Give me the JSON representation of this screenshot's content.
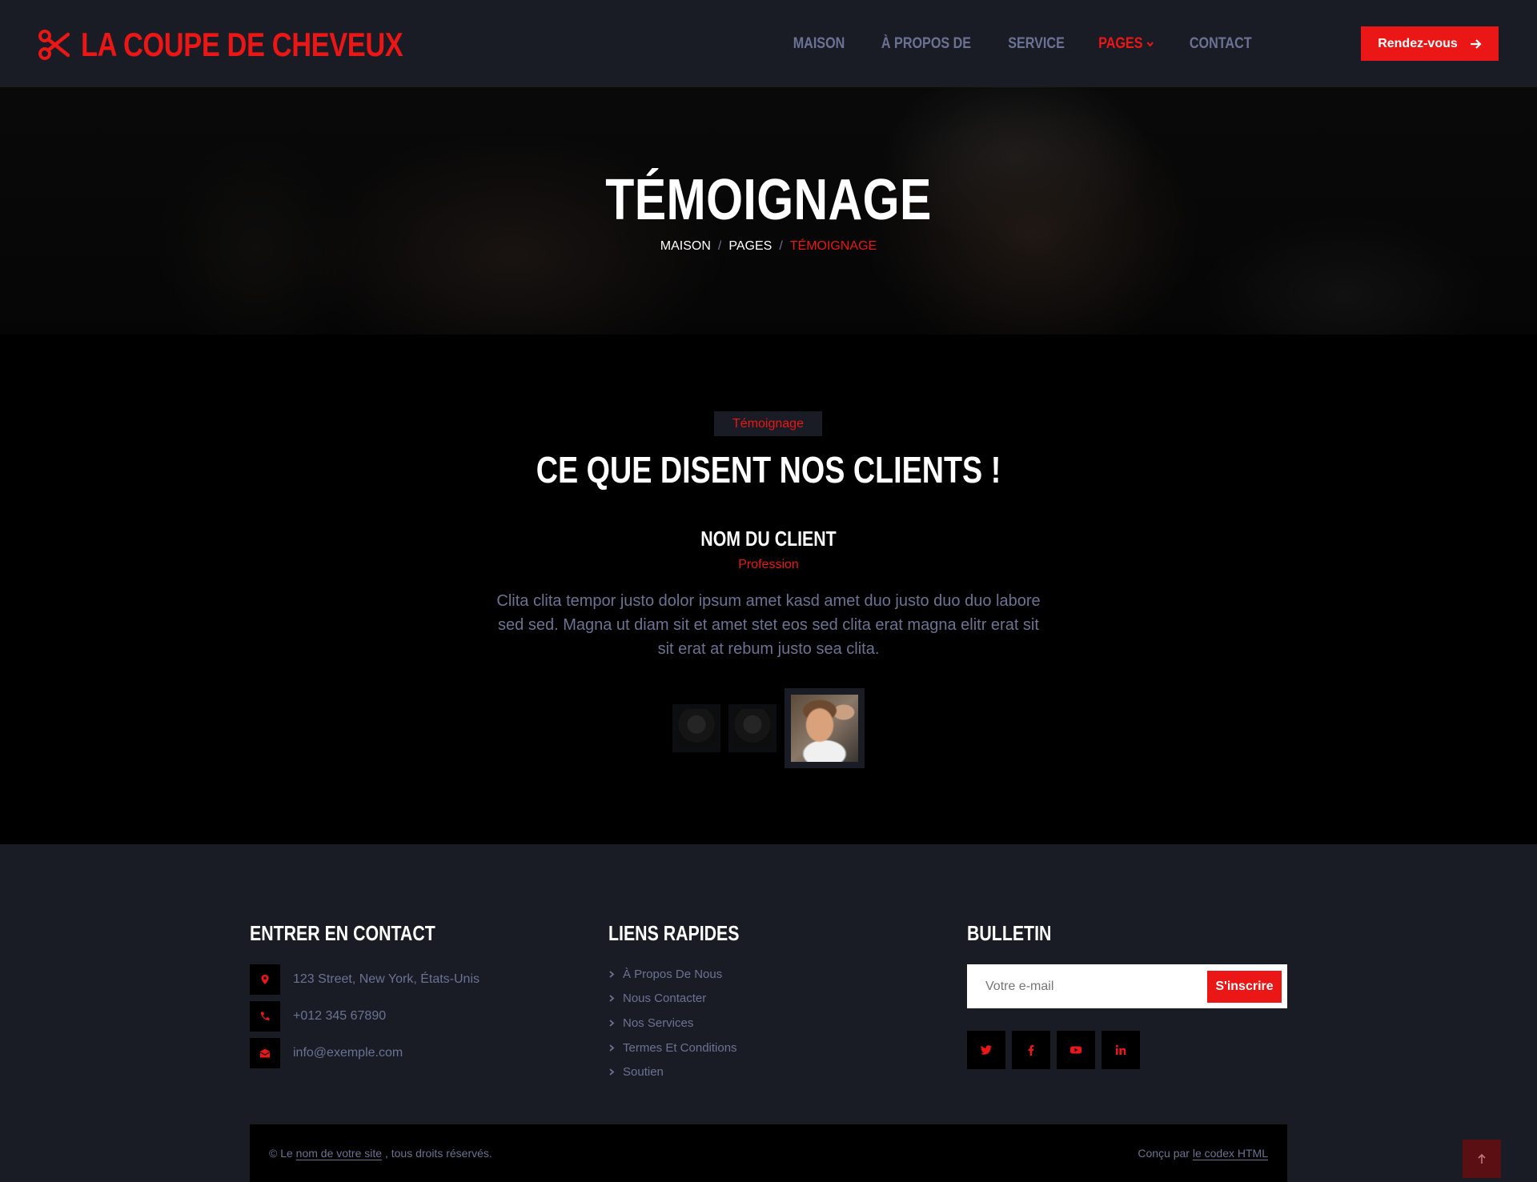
{
  "brand": {
    "title": "LA COUPE DE CHEVEUX",
    "icon": "scissors-icon"
  },
  "nav": {
    "items": [
      {
        "label": "MAISON"
      },
      {
        "label": "À PROPOS DE"
      },
      {
        "label": "SERVICE"
      },
      {
        "label": "PAGES",
        "active": true,
        "dropdown": true
      },
      {
        "label": "CONTACT"
      }
    ],
    "cta_label": "Rendez-vous"
  },
  "hero": {
    "title": "TÉMOIGNAGE",
    "breadcrumb": [
      "MAISON",
      "PAGES",
      "TÉMOIGNAGE"
    ],
    "separator": "/"
  },
  "testimonial": {
    "tag": "Témoignage",
    "heading": "CE QUE DISENT NOS CLIENTS !",
    "client_name": "NOM DU CLIENT",
    "profession": "Profession",
    "quote": "Clita clita tempor justo dolor ipsum amet kasd amet duo justo duo duo labore sed sed. Magna ut diam sit et amet stet eos sed clita erat magna elitr erat sit sit erat at rebum justo sea clita."
  },
  "footer": {
    "contact": {
      "title": "ENTRER EN CONTACT",
      "address": "123 Street, New York, États-Unis",
      "phone": "+012 345 67890",
      "email": "info@exemple.com"
    },
    "links": {
      "title": "LIENS RAPIDES",
      "items": [
        "À Propos De Nous",
        "Nous Contacter",
        "Nos Services",
        "Termes Et Conditions",
        "Soutien"
      ]
    },
    "newsletter": {
      "title": "BULLETIN",
      "placeholder": "Votre e-mail",
      "button": "S'inscrire"
    },
    "social": [
      "twitter-icon",
      "facebook-icon",
      "youtube-icon",
      "linkedin-icon"
    ],
    "copyright": {
      "prefix": "© Le",
      "site_link": "nom de votre site",
      "suffix": ", tous droits réservés.",
      "designed_prefix": "Conçu par",
      "designed_link": "le codex HTML"
    }
  },
  "colors": {
    "accent": "#eb1616",
    "dark": "#191c24",
    "muted": "#6c7293"
  }
}
